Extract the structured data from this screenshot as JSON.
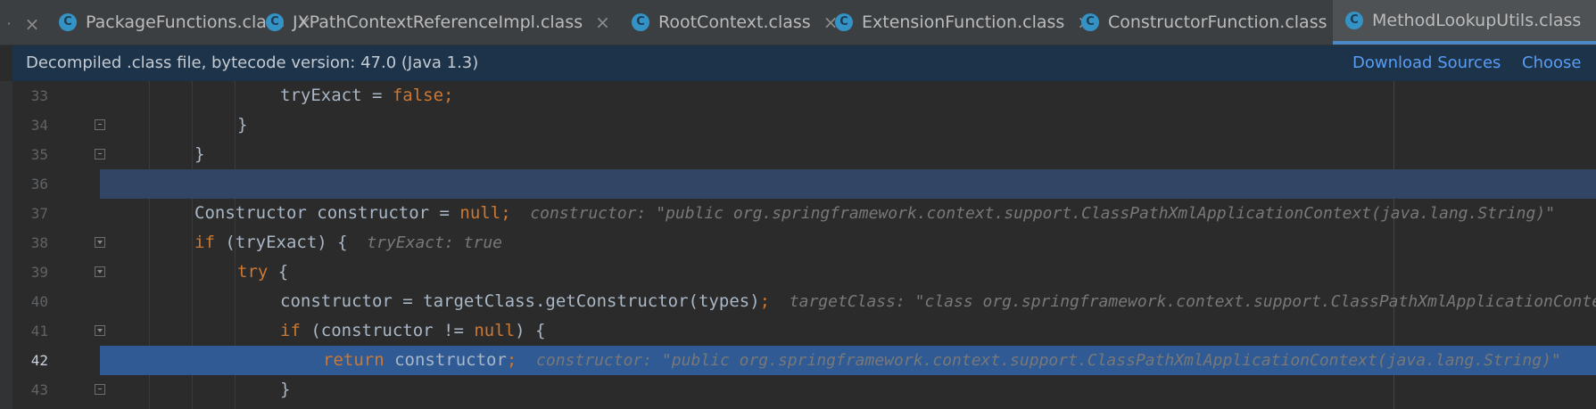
{
  "tabs": [
    {
      "label": "PackageFunctions.class",
      "icon": "class-icon",
      "active": false
    },
    {
      "label": "JXPathContextReferenceImpl.class",
      "icon": "class-icon",
      "active": false
    },
    {
      "label": "RootContext.class",
      "icon": "class-icon",
      "active": false
    },
    {
      "label": "ExtensionFunction.class",
      "icon": "class-icon",
      "active": false
    },
    {
      "label": "ConstructorFunction.class",
      "icon": "class-icon",
      "active": false
    },
    {
      "label": "MethodLookupUtils.class",
      "icon": "class-icon",
      "active": true
    }
  ],
  "tab_icon_letter": "C",
  "tab_close_glyph": "×",
  "banner": {
    "text": "Decompiled .class file, bytecode version: 47.0 (Java 1.3)",
    "download_sources": "Download Sources",
    "choose_sources": "Choose Sources..."
  },
  "lines": [
    {
      "num": "33",
      "code": [
        {
          "t": "tryExact = "
        },
        {
          "t": "false",
          "k": 1
        },
        {
          "t": ";",
          "k": 1
        }
      ],
      "hint": ""
    },
    {
      "num": "34",
      "code": [
        {
          "t": "}"
        }
      ],
      "hint": ""
    },
    {
      "num": "35",
      "code": [
        {
          "t": "}"
        }
      ],
      "hint": ""
    },
    {
      "num": "36",
      "code": [],
      "hint": ""
    },
    {
      "num": "37",
      "code": [
        {
          "t": "Constructor constructor = "
        },
        {
          "t": "null",
          "k": 1
        },
        {
          "t": ";",
          "k": 1
        }
      ],
      "hint": "constructor: \"public org.springframework.context.support.ClassPathXmlApplicationContext(java.lang.String)\""
    },
    {
      "num": "38",
      "code": [
        {
          "t": "if",
          "k": 1
        },
        {
          "t": " (tryExact) {"
        }
      ],
      "hint": "tryExact: true"
    },
    {
      "num": "39",
      "code": [
        {
          "t": "try",
          "k": 1
        },
        {
          "t": " {"
        }
      ],
      "hint": ""
    },
    {
      "num": "40",
      "code": [
        {
          "t": "constructor = targetClass.getConstructor(types)"
        },
        {
          "t": ";",
          "k": 1
        }
      ],
      "hint": "targetClass: \"class org.springframework.context.support.ClassPathXmlApplicationContext\""
    },
    {
      "num": "41",
      "code": [
        {
          "t": "if",
          "k": 1
        },
        {
          "t": " (constructor != "
        },
        {
          "t": "null",
          "k": 1
        },
        {
          "t": ") {"
        }
      ],
      "hint": ""
    },
    {
      "num": "42",
      "code": [
        {
          "t": "return",
          "k": 1
        },
        {
          "t": " constructor"
        },
        {
          "t": ";",
          "k": 1
        }
      ],
      "hint": "constructor: \"public org.springframework.context.support.ClassPathXmlApplicationContext(java.lang.String)\""
    },
    {
      "num": "43",
      "code": [
        {
          "t": "}"
        }
      ],
      "hint": ""
    }
  ],
  "colors": {
    "keyword": "#cc7832",
    "text": "#a9b7c6",
    "hint": "#787878",
    "current_line": "#2f5a93",
    "caret_line": "#324564",
    "banner_bg": "#1d3349",
    "link": "#589df6"
  }
}
